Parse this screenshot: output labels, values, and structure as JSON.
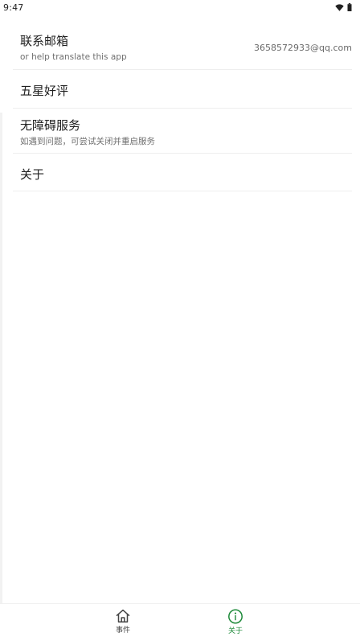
{
  "status_bar": {
    "time": "9:47",
    "icons": [
      "wifi-icon",
      "battery-icon"
    ]
  },
  "settings": {
    "contact_email": {
      "title": "联系邮箱",
      "subtitle": "or help translate this app",
      "value": "3658572933@qq.com"
    },
    "rate": {
      "title": "五星好评"
    },
    "accessibility": {
      "title": "无障碍服务",
      "subtitle": "如遇到问题，可尝试关闭并重启服务"
    },
    "about": {
      "title": "关于"
    }
  },
  "bottom_nav": {
    "events": {
      "label": "事件",
      "icon": "home-icon"
    },
    "about": {
      "label": "关于",
      "icon": "info-icon",
      "selected": true
    }
  },
  "colors": {
    "accent": "#1e8a3a",
    "text_primary": "#202020",
    "text_secondary": "#6f6f6f"
  }
}
